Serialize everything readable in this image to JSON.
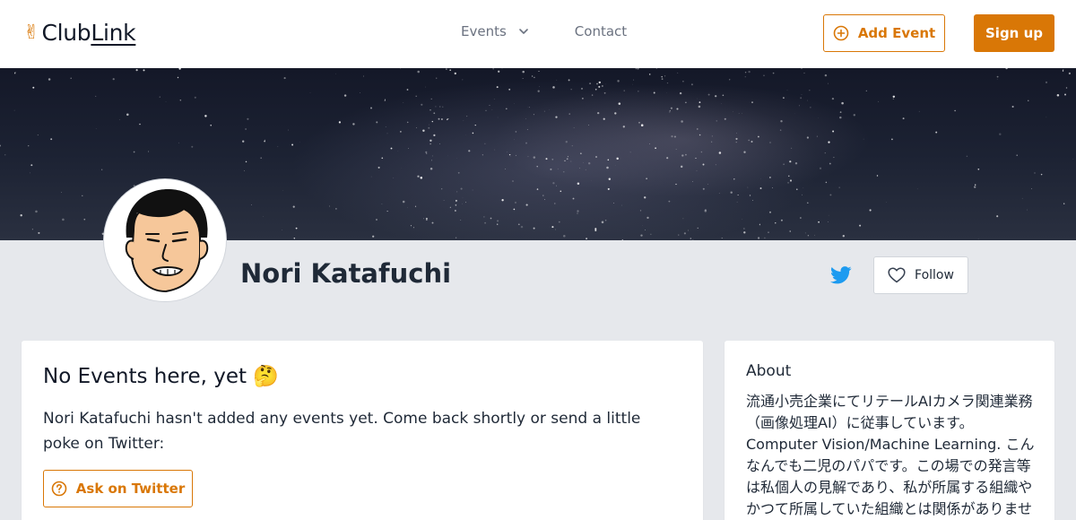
{
  "header": {
    "logo_icon": "victory-hand-icon",
    "logo_text_part1": "Club",
    "logo_text_part2": "Link",
    "nav": {
      "events_label": "Events",
      "contact_label": "Contact"
    },
    "add_event_label": "Add Event",
    "sign_up_label": "Sign up"
  },
  "profile": {
    "name": "Nori Katafuchi",
    "follow_label": "Follow",
    "twitter_icon": "twitter-icon"
  },
  "events": {
    "title": "No Events here, yet 🤔",
    "description": "Nori Katafuchi hasn't added any events yet. Come back shortly or send a little poke on Twitter:",
    "ask_label": "Ask on Twitter"
  },
  "about": {
    "title": "About",
    "text": "流通小売企業にてリテールAIカメラ関連業務（画像処理AI）に従事しています。Computer Vision/Machine Learning. こんなんでも二児のパパです。この場での発言等は私個人の見解であり、私が所属する組織やかつて所属していた組織とは関係がありませ"
  },
  "colors": {
    "accent": "#d97706",
    "background": "#e6e8ec",
    "twitter": "#1d9bf0"
  }
}
